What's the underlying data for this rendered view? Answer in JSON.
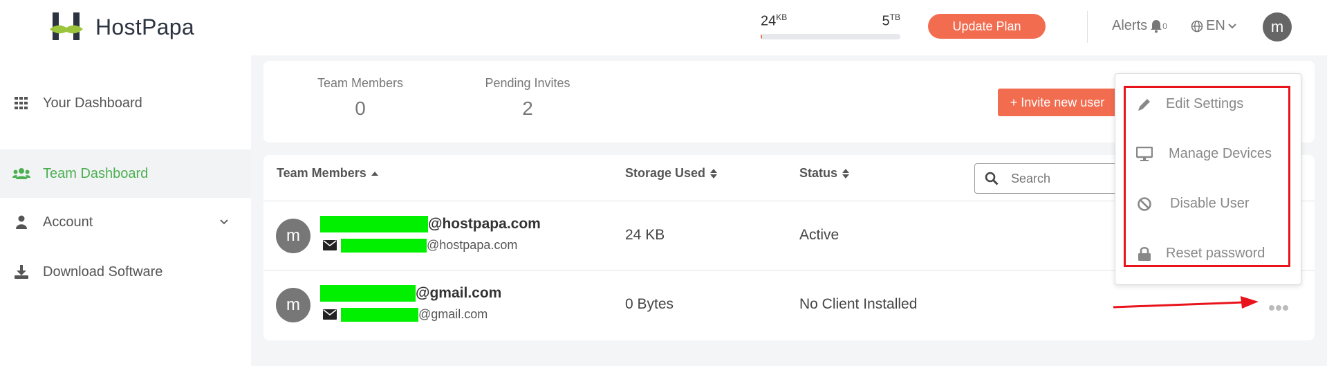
{
  "brand": {
    "name": "HostPapa"
  },
  "usage": {
    "used": "24",
    "used_unit": "KB",
    "total": "5",
    "total_unit": "TB",
    "fill_percent": 1
  },
  "header": {
    "update_plan_label": "Update Plan",
    "alerts_label": "Alerts",
    "alerts_count": "0",
    "language": "EN",
    "user_initial": "m"
  },
  "sidebar": {
    "items": [
      {
        "label": "Your Dashboard",
        "icon": "grid-icon",
        "active": false
      },
      {
        "label": "Team Dashboard",
        "icon": "users-icon",
        "active": true
      },
      {
        "label": "Account",
        "icon": "user-icon",
        "active": false
      },
      {
        "label": "Download Software",
        "icon": "download-icon",
        "active": false
      }
    ]
  },
  "summary": {
    "team_members_label": "Team Members",
    "team_members_value": "0",
    "pending_invites_label": "Pending Invites",
    "pending_invites_value": "2",
    "invite_label": "+ Invite new user"
  },
  "table": {
    "columns": [
      "Team Members",
      "Storage Used",
      "Status"
    ],
    "search_placeholder": "Search",
    "rows": [
      {
        "initial": "m",
        "email_domain": "@hostpapa.com",
        "sub_domain": "@hostpapa.com",
        "storage": "24 KB",
        "status": "Active"
      },
      {
        "initial": "m",
        "email_domain": "@gmail.com",
        "sub_domain": "@gmail.com",
        "storage": "0 Bytes",
        "status": "No Client Installed"
      }
    ]
  },
  "menu": {
    "items": [
      {
        "label": "Edit Settings",
        "icon": "pencil-icon"
      },
      {
        "label": "Manage Devices",
        "icon": "monitor-icon"
      },
      {
        "label": "Disable User",
        "icon": "ban-icon"
      },
      {
        "label": "Reset password",
        "icon": "lock-icon"
      }
    ]
  },
  "colors": {
    "accent": "#f26c4f",
    "active_nav": "#4caf50",
    "highlight": "#e8131b",
    "redaction": "#00f000"
  }
}
